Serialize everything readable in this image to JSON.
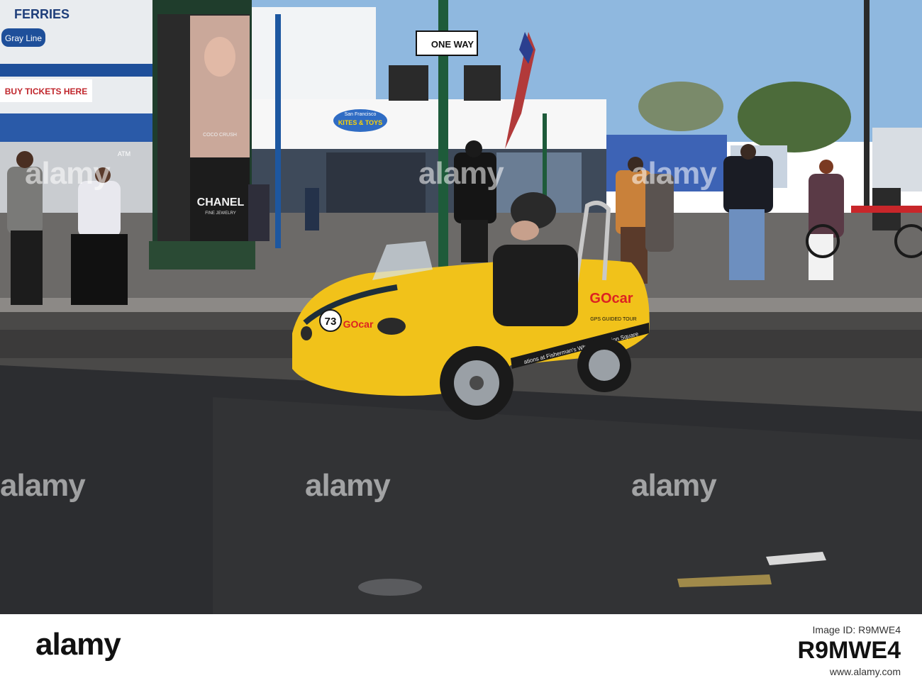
{
  "photo": {
    "signs": {
      "ferries": "FERRIES",
      "gray_line": "Gray Line",
      "buy_tickets": "BUY TICKETS HERE",
      "one_way": "ONE WAY",
      "kites_toys": "KITES & TOYS",
      "san_francisco": "San Francisco",
      "chanel": "CHANEL",
      "coco_crush": "COCO CRUSH",
      "fine_jewelry": "FINE JEWELRY",
      "atm": "ATM"
    },
    "gocar": {
      "number": "73",
      "brand": "GOcar",
      "tagline": "GPS GUIDED TOUR",
      "side_text": "ations at Fisherman's Wharf and Union Square"
    },
    "watermarks": [
      "alamy",
      "alamy",
      "alamy"
    ]
  },
  "footer": {
    "logo": "alamy",
    "line1": "Image ID: R9MWE4",
    "image_id": "R9MWE4",
    "url": "www.alamy.com"
  }
}
